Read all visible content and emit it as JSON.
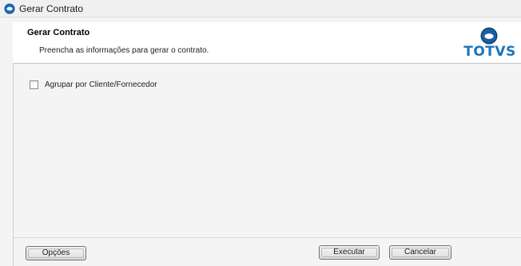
{
  "window": {
    "title": "Gerar Contrato",
    "icon": "totvs-logo-icon"
  },
  "header": {
    "title": "Gerar Contrato",
    "subtitle": "Preencha as informações para gerar o contrato.",
    "logo_text": "TOTVS",
    "logo_color": "#1b75bb"
  },
  "form": {
    "agrupar_label": "Agrupar por Cliente/Fornecedor",
    "agrupar_checked": false
  },
  "footer": {
    "opcoes_label": "Opções",
    "executar_label": "Executar",
    "cancelar_label": "Cancelar"
  }
}
